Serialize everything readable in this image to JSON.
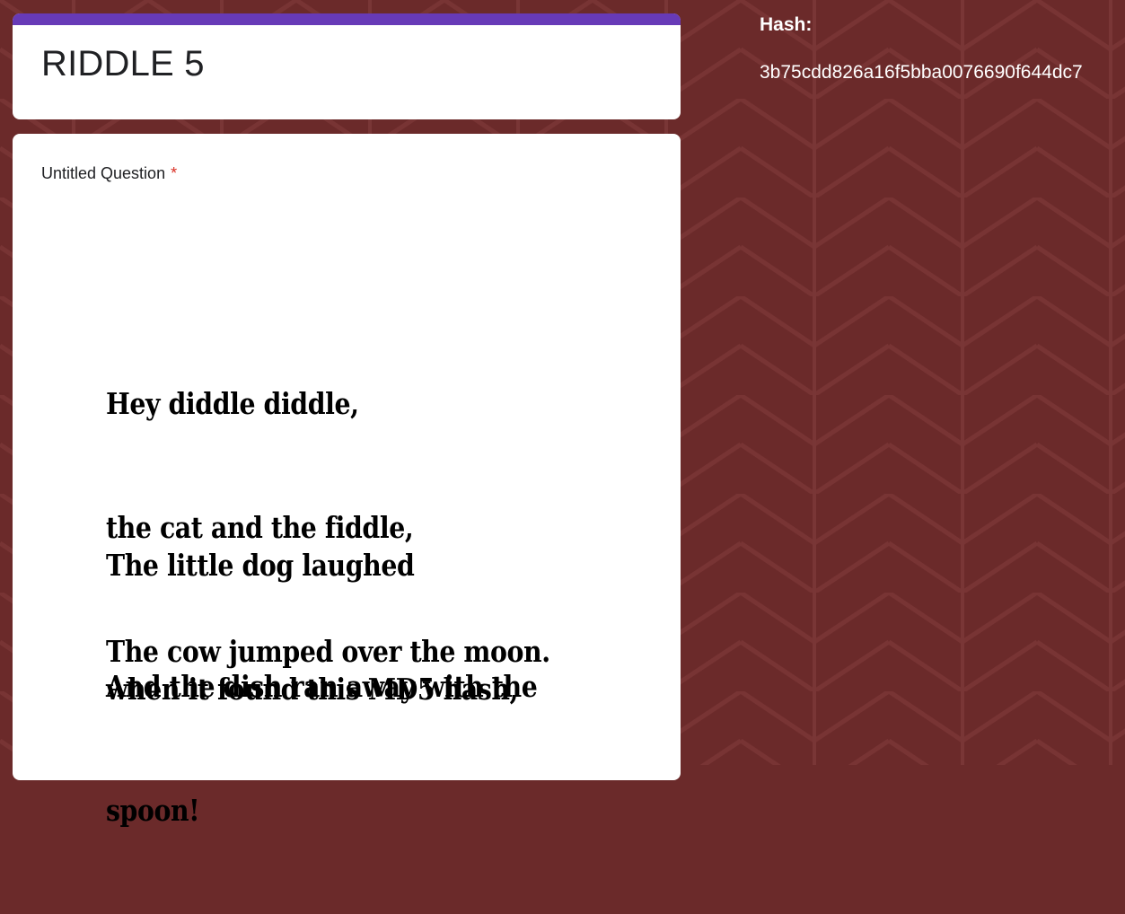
{
  "theme": {
    "accent_color": "#673ab7",
    "background_color": "#6b2a2a",
    "card_color": "#ffffff"
  },
  "form": {
    "title": "RIDDLE 5"
  },
  "question": {
    "title": "Untitled Question",
    "required_marker": "*",
    "image_text": {
      "stanza_1": [
        "Hey diddle diddle,",
        "the cat and the fiddle,",
        "The cow jumped over the moon."
      ],
      "stanza_2": [
        "The little dog laughed",
        "when it found this MD5 hash,"
      ],
      "stanza_3": [
        "And the dish ran away with the",
        "spoon!"
      ]
    }
  },
  "hash_panel": {
    "label": "Hash:",
    "value": "3b75cdd826a16f5bba0076690f644dc7"
  }
}
